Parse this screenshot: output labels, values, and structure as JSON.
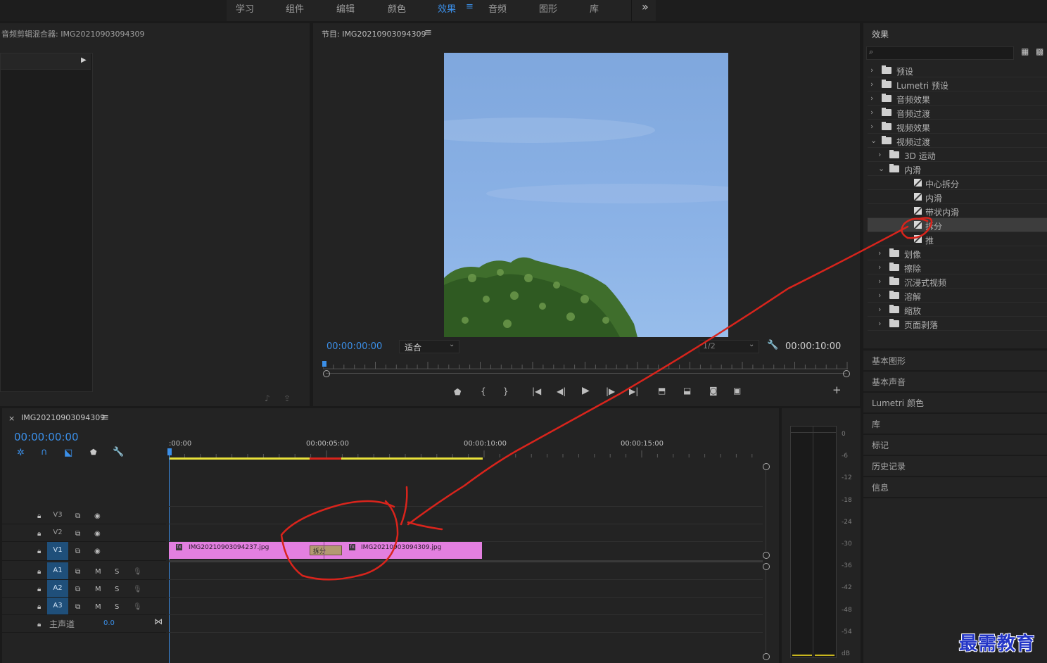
{
  "workspace_tabs": [
    "学习",
    "组件",
    "编辑",
    "颜色",
    "效果",
    "音频",
    "图形",
    "库"
  ],
  "active_tab_index": 4,
  "more_glyph": "»",
  "audio_clip_mixer": {
    "title": "音频剪辑混合器: IMG20210903094309"
  },
  "program_monitor": {
    "title": "节目: IMG20210903094309",
    "timecode_left": "00:00:00:00",
    "fit_option": "适合",
    "resolution": "1/2",
    "timecode_right": "00:00:10:00"
  },
  "effects_panel": {
    "title": "效果",
    "search_placeholder": "",
    "tree": [
      {
        "label": "预设",
        "kind": "preset",
        "chev": "›"
      },
      {
        "label": "Lumetri 预设",
        "kind": "preset",
        "chev": "›"
      },
      {
        "label": "音频效果",
        "kind": "folder",
        "chev": "›"
      },
      {
        "label": "音频过渡",
        "kind": "folder",
        "chev": "›"
      },
      {
        "label": "视频效果",
        "kind": "folder",
        "chev": "›"
      },
      {
        "label": "视频过渡",
        "kind": "folder",
        "chev": "⌄"
      },
      {
        "label": "3D 运动",
        "kind": "folder",
        "chev": "›"
      },
      {
        "label": "内滑",
        "kind": "folder",
        "chev": "⌄"
      },
      {
        "label": "中心拆分",
        "kind": "fx",
        "chev": ""
      },
      {
        "label": "内滑",
        "kind": "fx",
        "chev": ""
      },
      {
        "label": "带状内滑",
        "kind": "fx",
        "chev": ""
      },
      {
        "label": "拆分",
        "kind": "fx",
        "chev": "",
        "selected": true
      },
      {
        "label": "推",
        "kind": "fx",
        "chev": ""
      },
      {
        "label": "划像",
        "kind": "folder",
        "chev": "›"
      },
      {
        "label": "擦除",
        "kind": "folder",
        "chev": "›"
      },
      {
        "label": "沉浸式视频",
        "kind": "folder",
        "chev": "›"
      },
      {
        "label": "溶解",
        "kind": "folder",
        "chev": "›"
      },
      {
        "label": "缩放",
        "kind": "folder",
        "chev": "›"
      },
      {
        "label": "页面剥落",
        "kind": "folder",
        "chev": "›"
      }
    ]
  },
  "side_panels": [
    "基本图形",
    "基本声音",
    "Lumetri 颜色",
    "库",
    "标记",
    "历史记录",
    "信息"
  ],
  "timeline": {
    "sequence_name": "IMG20210903094309",
    "timecode": "00:00:00:00",
    "ruler": [
      ":00:00",
      "00:00:05:00",
      "00:00:10:00",
      "00:00:15:00"
    ],
    "tracks": {
      "video": [
        "V3",
        "V2",
        "V1"
      ],
      "audio": [
        "A1",
        "A2",
        "A3"
      ],
      "mix_label": "主声道",
      "mix_value": "0.0"
    },
    "m_label": "M",
    "s_label": "S",
    "clips": [
      {
        "name": "IMG20210903094237.jpg"
      },
      {
        "name": "IMG20210903094309.jpg"
      }
    ],
    "transition_label": "拆分"
  },
  "meter_labels": [
    "0",
    "-6",
    "-12",
    "-18",
    "-24",
    "-30",
    "-36",
    "-42",
    "-48",
    "-54",
    "dB"
  ],
  "watermark": "最需教育",
  "colors": {
    "accent": "#3b8fe8",
    "clip": "#e37fe0",
    "annotation": "#d9241c",
    "workarea": "#e8e13a"
  }
}
